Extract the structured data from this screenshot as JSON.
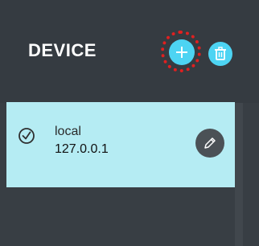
{
  "header": {
    "title": "DEVICE",
    "add_button": {
      "icon": "plus-icon",
      "color": "#4dd4f3"
    },
    "delete_button": {
      "icon": "trash-icon",
      "color": "#4dd4f3"
    },
    "highlight_color": "#e02020"
  },
  "devices": [
    {
      "name": "local",
      "address": "127.0.0.1",
      "status_icon": "check-circle-icon",
      "edit_icon": "pencil-icon",
      "selected": true
    }
  ],
  "colors": {
    "background": "#353b41",
    "selected_card": "#b5ecf3",
    "edit_button": "#4b5156"
  }
}
